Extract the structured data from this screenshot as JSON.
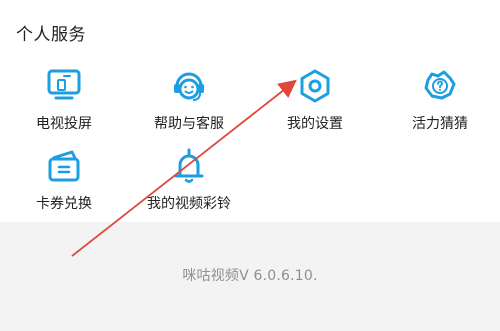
{
  "section": {
    "title": "个人服务"
  },
  "services": [
    {
      "label": "电视投屏",
      "icon": "tv-cast-icon"
    },
    {
      "label": "帮助与客服",
      "icon": "customer-service-icon"
    },
    {
      "label": "我的设置",
      "icon": "settings-icon"
    },
    {
      "label": "活力猜猜",
      "icon": "quiz-icon"
    },
    {
      "label": "卡券兑换",
      "icon": "coupon-icon"
    },
    {
      "label": "我的视频彩铃",
      "icon": "video-ringtone-icon"
    }
  ],
  "footer": {
    "version": "咪咕视频V 6.0.6.10."
  },
  "colors": {
    "icon_blue": "#1d9ee0",
    "arrow_red": "#e0473b",
    "background_gray": "#f3f3f3"
  }
}
